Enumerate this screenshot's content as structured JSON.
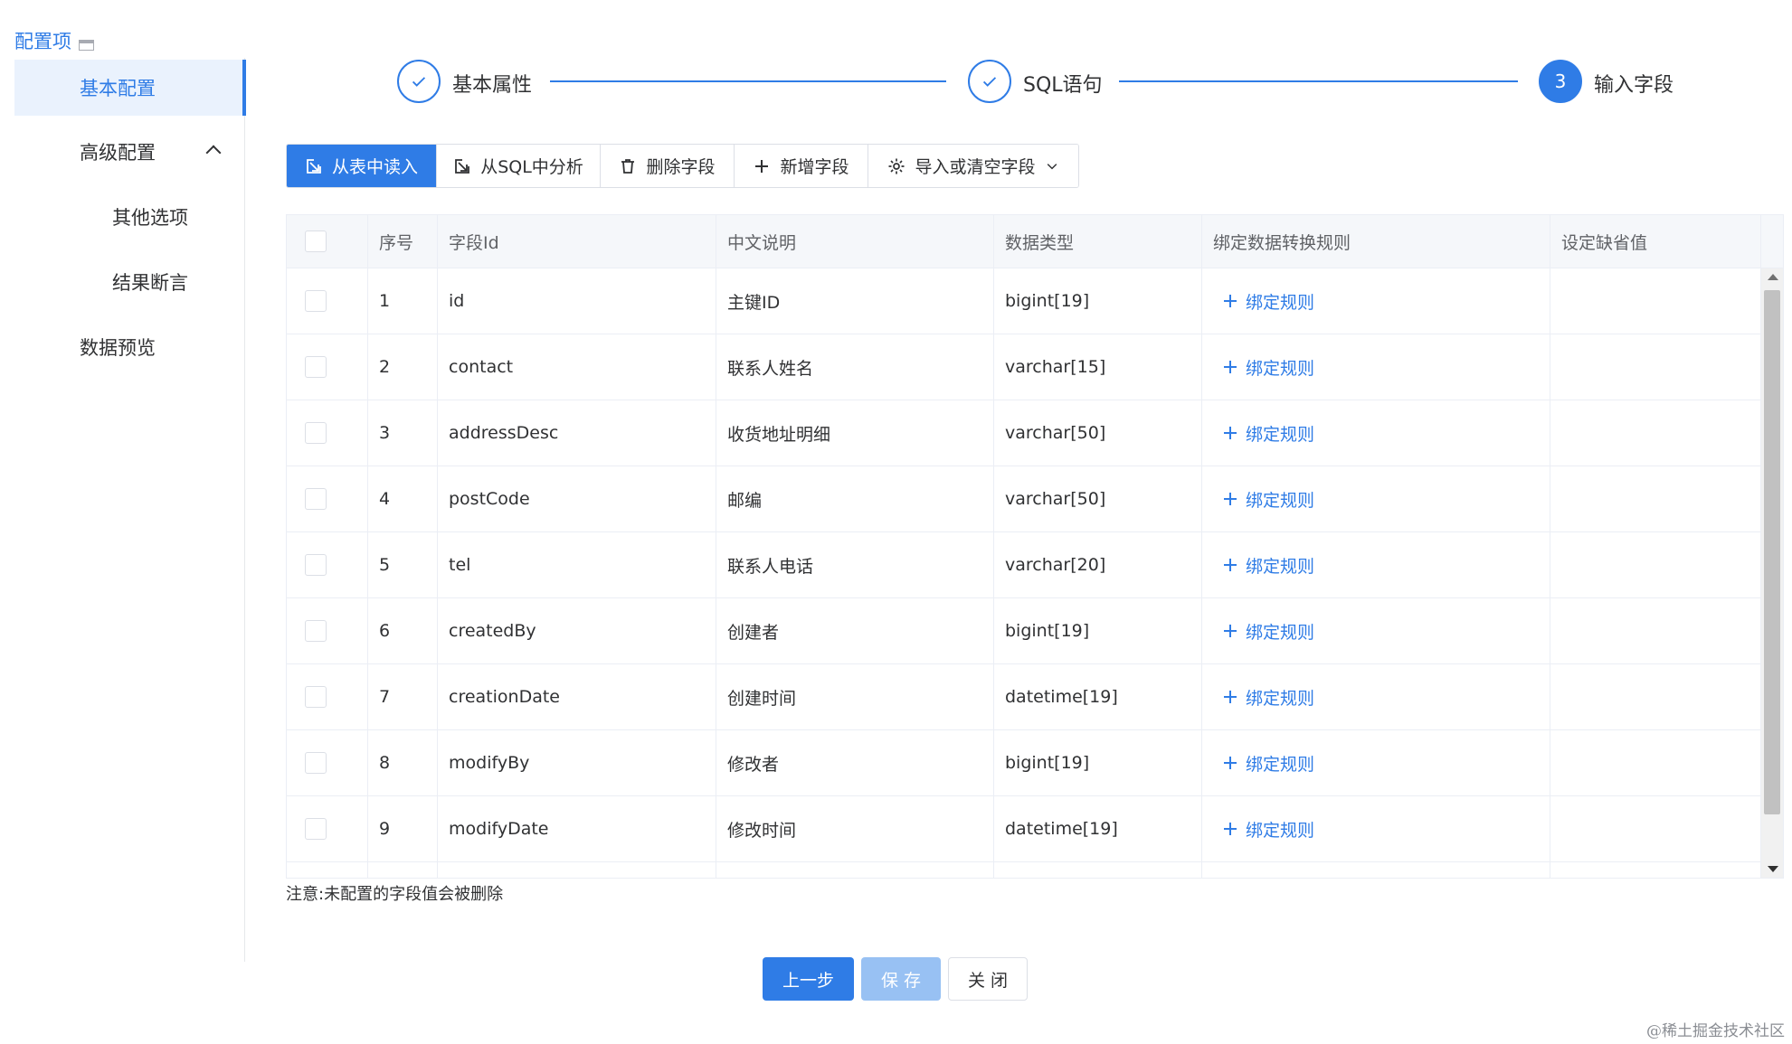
{
  "header": {
    "crumb_label": "配置项"
  },
  "sidebar": {
    "items": [
      {
        "label": "基本配置"
      },
      {
        "label": "高级配置"
      },
      {
        "label": "其他选项"
      },
      {
        "label": "结果断言"
      },
      {
        "label": "数据预览"
      }
    ]
  },
  "steps": [
    {
      "label": "基本属性",
      "state": "done"
    },
    {
      "label": "SQL语句",
      "state": "done"
    },
    {
      "label": "输入字段",
      "state": "current",
      "number": "3"
    }
  ],
  "toolbar": {
    "read_from_table": "从表中读入",
    "analyze_sql": "从SQL中分析",
    "delete_field": "删除字段",
    "add_field": "新增字段",
    "import_clear": "导入或清空字段"
  },
  "table": {
    "columns": [
      "序号",
      "字段Id",
      "中文说明",
      "数据类型",
      "绑定数据转换规则",
      "设定缺省值"
    ],
    "bind_label": "绑定规则",
    "rows": [
      {
        "no": "1",
        "field_id": "id",
        "desc": "主键ID",
        "type": "bigint[19]",
        "default": ""
      },
      {
        "no": "2",
        "field_id": "contact",
        "desc": "联系人姓名",
        "type": "varchar[15]",
        "default": ""
      },
      {
        "no": "3",
        "field_id": "addressDesc",
        "desc": "收货地址明细",
        "type": "varchar[50]",
        "default": ""
      },
      {
        "no": "4",
        "field_id": "postCode",
        "desc": "邮编",
        "type": "varchar[50]",
        "default": ""
      },
      {
        "no": "5",
        "field_id": "tel",
        "desc": "联系人电话",
        "type": "varchar[20]",
        "default": ""
      },
      {
        "no": "6",
        "field_id": "createdBy",
        "desc": "创建者",
        "type": "bigint[19]",
        "default": ""
      },
      {
        "no": "7",
        "field_id": "creationDate",
        "desc": "创建时间",
        "type": "datetime[19]",
        "default": ""
      },
      {
        "no": "8",
        "field_id": "modifyBy",
        "desc": "修改者",
        "type": "bigint[19]",
        "default": ""
      },
      {
        "no": "9",
        "field_id": "modifyDate",
        "desc": "修改时间",
        "type": "datetime[19]",
        "default": ""
      }
    ]
  },
  "note": "注意:未配置的字段值会被删除",
  "footer": {
    "prev": "上一步",
    "save": "保 存",
    "close": "关 闭"
  },
  "watermark": "@稀土掘金技术社区",
  "colors": {
    "accent": "#2f7ce6",
    "accent_light": "#eaf2fd",
    "save_disabled": "#98c1f3"
  }
}
